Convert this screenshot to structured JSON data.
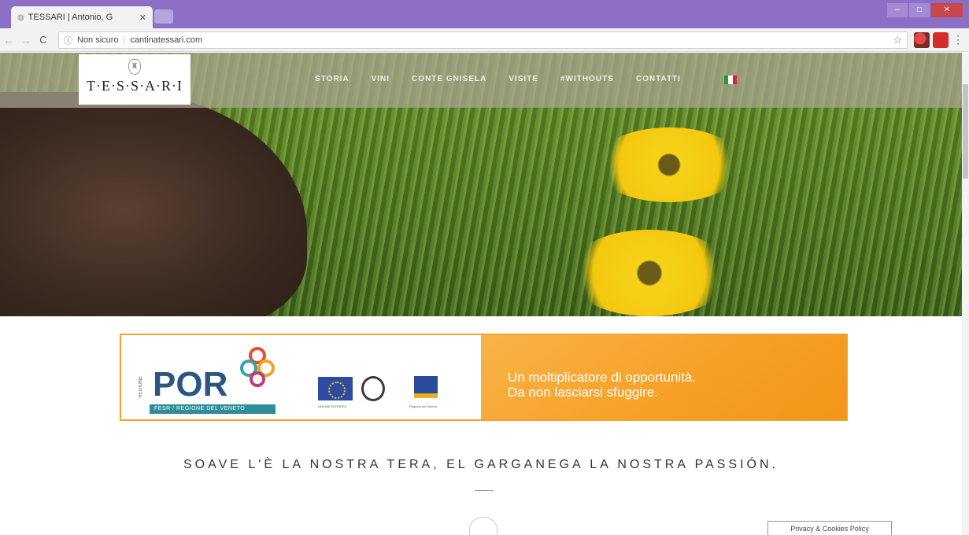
{
  "browser": {
    "tab_title": "TESSARI | Antonio, G",
    "tab_close": "✕",
    "secure_label": "Non sicuro",
    "url": "cantinatessari.com"
  },
  "header": {
    "logo_text": "T·E·S·S·A·R·I",
    "nav": [
      "STORIA",
      "VINI",
      "CONTE GNISELA",
      "VISITE",
      "#WITHOUTS",
      "CONTATTI"
    ],
    "flag_colors": [
      "#1f9a3a",
      "#ffffff",
      "#d7262f"
    ]
  },
  "banner": {
    "por": "POR",
    "por_side": "REGIONE",
    "por_strip": "FESR / REGIONE DEL VENETO",
    "eu_caption": "UNIONE EUROPEA",
    "veneto_caption": "Regione del Veneto",
    "line1": "Un moltiplicatore di opportunità.",
    "line2": "Da non lasciarsi sfuggire."
  },
  "tagline": "SOAVE L'È LA NOSTRA TERA, EL GARGANEGA LA NOSTRA PASSIÓN.",
  "cookie_label": "Privacy & Cookies Policy"
}
